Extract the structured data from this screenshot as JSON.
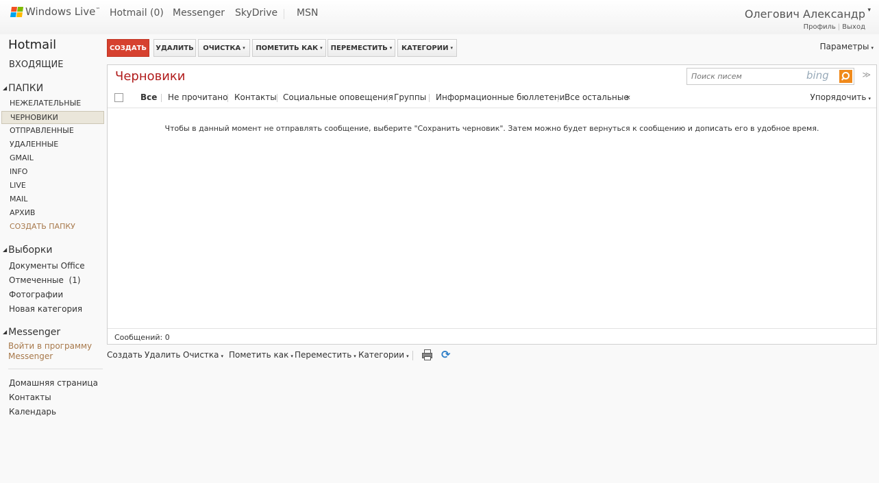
{
  "colors": {
    "accent_red": "#d6412f",
    "folder_title": "#b11c1c",
    "link_brown": "#a7784a"
  },
  "topbar": {
    "brand": "Windows Live",
    "brand_tm": "™",
    "nav": [
      "Hotmail (0)",
      "Messenger",
      "SkyDrive",
      "MSN"
    ],
    "user_name": "Олегович Александр",
    "user_caret": "▾",
    "profile": "Профиль",
    "sep": "|",
    "logout": "Выход"
  },
  "sidebar": {
    "title": "Hotmail",
    "inbox": "ВХОДЯЩИЕ",
    "folders_header": "ПАПКИ",
    "folders": [
      "НЕЖЕЛАТЕЛЬНЫЕ",
      "ЧЕРНОВИКИ",
      "ОТПРАВЛЕННЫЕ",
      "УДАЛЕННЫЕ",
      "GMAIL",
      "INFO",
      "LIVE",
      "MAIL",
      "АРХИВ"
    ],
    "active_folder": "ЧЕРНОВИКИ",
    "create_folder": "СОЗДАТЬ ПАПКУ",
    "views_header": "Выборки",
    "views": [
      "Документы Office",
      "Отмеченные  (1)",
      "Фотографии"
    ],
    "new_category": "Новая категория",
    "messenger_header": "Messenger",
    "messenger_signin_1": "Войти в программу",
    "messenger_signin_2": "Messenger",
    "links": [
      "Домашняя страница",
      "Контакты",
      "Календарь"
    ]
  },
  "toolbar": {
    "create": "СОЗДАТЬ",
    "delete": "УДАЛИТЬ",
    "sweep": "ОЧИСТКА",
    "mark_as": "ПОМЕТИТЬ КАК",
    "move": "ПЕРЕМЕСТИТЬ",
    "categories": "КАТЕГОРИИ",
    "params": "Параметры",
    "dropdown_glyph": "▾"
  },
  "main": {
    "folder_title": "Черновики",
    "search_placeholder": "Поиск писем",
    "search_brand": "bing",
    "collapse_glyph": "≫",
    "filters": [
      "Все",
      "Не прочитано",
      "Контакты",
      "Социальные оповещения",
      "Группы",
      "Информационные бюллетени",
      "Все остальные"
    ],
    "filters_toggle": "«",
    "sort": "Упорядочить",
    "empty_message": "Чтобы в данный момент не отправлять сообщение, выберите \"Сохранить черновик\". Затем можно будет вернуться к сообщению и дописать его в удобное время.",
    "message_count": "Сообщений: 0"
  },
  "bottom_toolbar": {
    "create": "Создать",
    "delete": "Удалить",
    "sweep": "Очистка",
    "mark_as": "Пометить как",
    "move": "Переместить",
    "categories": "Категории",
    "print_icon": "printer-icon",
    "refresh_icon": "refresh-icon",
    "refresh_glyph": "⟳"
  }
}
